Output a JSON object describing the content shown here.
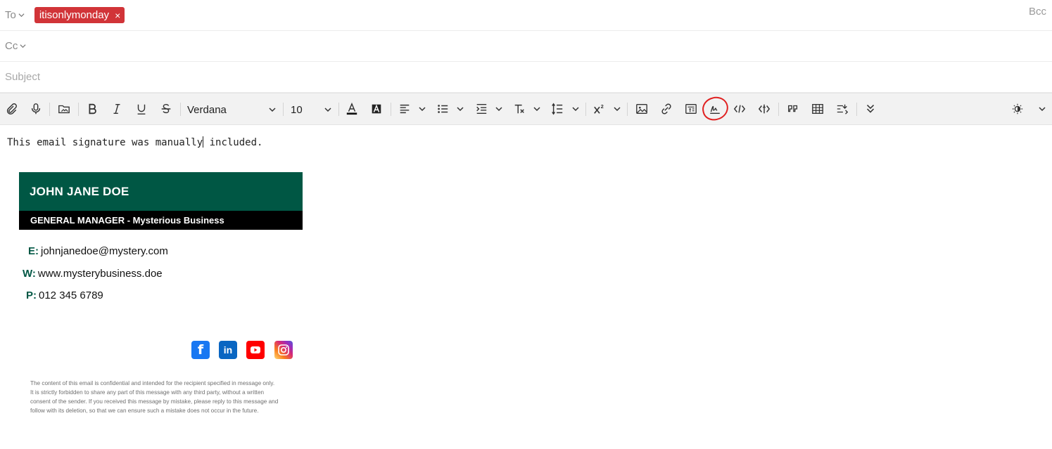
{
  "header": {
    "to_label": "To",
    "cc_label": "Cc",
    "bcc_label": "Bcc",
    "recipient_chip": "itisonlymonday",
    "chip_remove": "×",
    "subject_placeholder": "Subject"
  },
  "toolbar": {
    "font_family": "Verdana",
    "font_size": "10",
    "icons": [
      "paperclip-icon",
      "microphone-icon",
      "insert-image-folder-icon",
      "bold-icon",
      "italic-icon",
      "underline-icon",
      "strikethrough-icon",
      "font-color-icon",
      "highlight-color-icon",
      "align-icon",
      "bullet-list-icon",
      "indent-icon",
      "clear-format-icon",
      "line-spacing-icon",
      "superscript-icon",
      "image-icon",
      "link-icon",
      "template-icon",
      "signature-icon",
      "code-icon",
      "html-icon",
      "quote-icon",
      "table-icon",
      "text-direction-icon",
      "more-icon",
      "theme-icon"
    ]
  },
  "body": {
    "text_before_cursor": "This email signature was manually",
    "text_after_cursor": " included."
  },
  "signature": {
    "name": "JOHN JANE DOE",
    "title": "GENERAL MANAGER - Mysterious Business",
    "email_label": "E:",
    "email": "johnjanedoe@mystery.com",
    "web_label": "W:",
    "web": "www.mysterybusiness.doe",
    "phone_label": "P:",
    "phone": "012 345 6789",
    "colors": {
      "primary": "#005744",
      "secondary": "#000000"
    },
    "social": [
      "facebook-icon",
      "linkedin-icon",
      "youtube-icon",
      "instagram-icon"
    ],
    "disclaimer_lines": [
      "The content of this email is confidential and intended for the recipient specified in message only.",
      "It is strictly forbidden to share any part of this message with any third party, without a written",
      "consent of the sender. If you received this message by mistake, please reply to this message and",
      "follow with its deletion, so that we can ensure such a mistake does not occur in the future."
    ]
  }
}
